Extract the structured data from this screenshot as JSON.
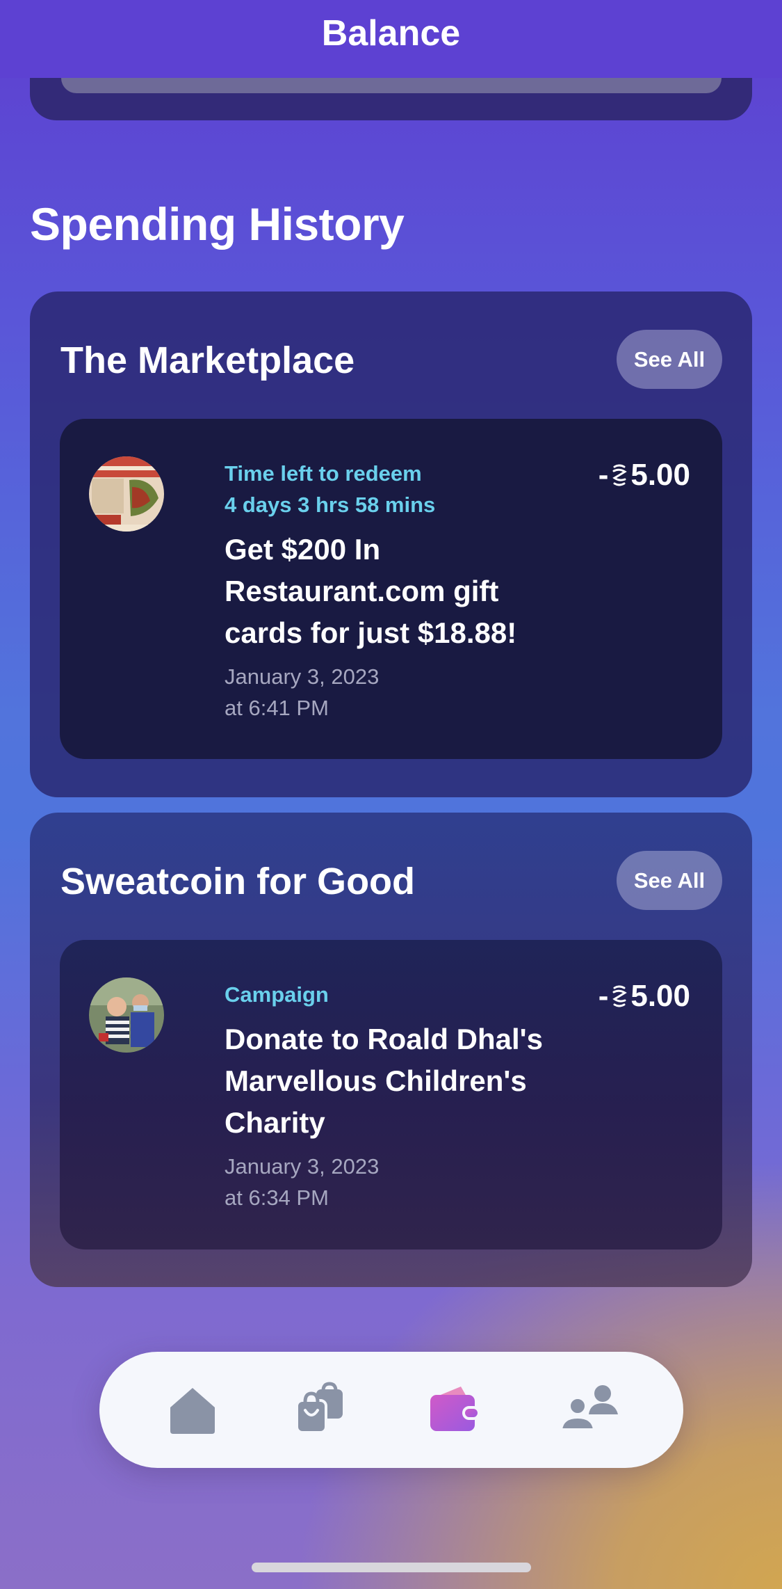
{
  "header": {
    "title": "Balance"
  },
  "spending_history": {
    "title": "Spending History"
  },
  "marketplace": {
    "title": "The Marketplace",
    "see_all_label": "See All",
    "item": {
      "eyebrow_line1": "Time left to redeem",
      "eyebrow_line2": "4 days 3 hrs 58 mins",
      "title": "Get $200 In Restaurant.com gift cards for just $18.88!",
      "date_line1": "January 3, 2023",
      "date_line2": "at 6:41 PM",
      "amount_sign": "-",
      "amount_value": "5.00",
      "thumbnail_icon": "restaurant-gift-card-thumbnail"
    }
  },
  "sweatcoin_for_good": {
    "title": "Sweatcoin for Good",
    "see_all_label": "See All",
    "item": {
      "eyebrow": "Campaign",
      "title": "Donate to Roald Dhal's Marvellous Children's Charity",
      "date_line1": "January 3, 2023",
      "date_line2": "at 6:34 PM",
      "amount_sign": "-",
      "amount_value": "5.00",
      "thumbnail_icon": "charity-campaign-photo"
    }
  },
  "bottom_nav": {
    "items": [
      {
        "icon": "home-icon",
        "active": false
      },
      {
        "icon": "shopping-bag-icon",
        "active": false
      },
      {
        "icon": "wallet-icon",
        "active": true
      },
      {
        "icon": "people-icon",
        "active": false
      }
    ]
  },
  "colors": {
    "accent_cyan": "#6ad0ec",
    "active_nav": "#c55fd0",
    "inactive_nav": "#8a93a6"
  }
}
